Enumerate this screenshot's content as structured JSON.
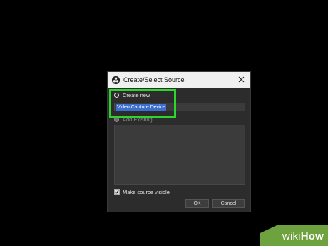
{
  "dialog": {
    "title": "Create/Select Source",
    "create_new_label": "Create new",
    "source_name_value": "Video Capture Device",
    "add_existing_label": "Add Existing",
    "make_visible_label": "Make source visible",
    "make_visible_checked": true,
    "ok_label": "OK",
    "cancel_label": "Cancel"
  },
  "watermark": {
    "wiki": "wiki",
    "how": "How"
  },
  "colors": {
    "highlight": "#2dd62d",
    "selection": "#3d6fd0",
    "watermark_bg": "#6ea23e"
  },
  "icons": [
    "obs-app-icon",
    "close-icon",
    "checkmark-icon"
  ]
}
